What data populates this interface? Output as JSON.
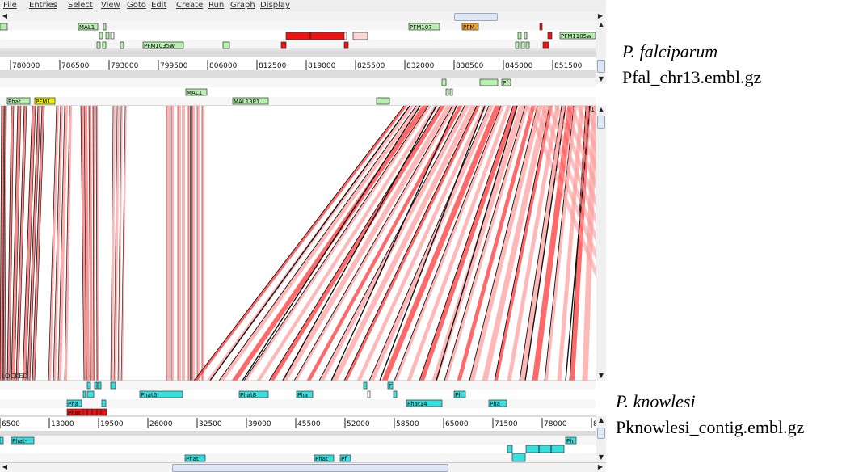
{
  "menu": [
    "File",
    "Entries",
    "Select",
    "View",
    "Goto",
    "Edit",
    "Create",
    "Run",
    "Graph",
    "Display"
  ],
  "top_genome": {
    "species": "P. falciparum",
    "file": "Pfal_chr13.embl.gz",
    "ruler_ticks": [
      "780000",
      "786500",
      "793000",
      "799500",
      "806000",
      "812500",
      "819000",
      "825500",
      "832000",
      "838500",
      "845000",
      "851500"
    ],
    "feature_labels": [
      "MAL1",
      "PFM107",
      "PFM",
      "PFM1035w",
      "PFM1105w"
    ],
    "lower_feature_labels": [
      "MAL1",
      "Pf",
      "Phat",
      "PFM1",
      "MAL13P1."
    ]
  },
  "bottom_genome": {
    "species": "P. knowlesi",
    "file": "Pknowlesi_contig.embl.gz",
    "ruler_ticks": [
      "6500",
      "13000",
      "19500",
      "26000",
      "32500",
      "39000",
      "45500",
      "52000",
      "58500",
      "65000",
      "71500",
      "78000",
      "84"
    ],
    "feature_labels": [
      "Phat6",
      "Phat8",
      "Pha",
      "Ph",
      "Pha",
      "Phat14",
      "Pha",
      "Phat",
      "F"
    ],
    "lower_feature_labels": [
      "Phat-",
      "Ph",
      "Phat",
      "Phat",
      "Pf"
    ]
  },
  "comparison": {
    "status_text": "LOCKED",
    "marker_right": "1"
  },
  "colors": {
    "match_dark": "#111111",
    "match_red": "#ff2a2a",
    "match_pink": "#ff9a9a",
    "gene_green": "#b8f0b0",
    "gene_cyan": "#34e0e0",
    "gene_red": "#ee1111",
    "gene_orange": "#f4a020",
    "gene_yellow": "#f4f400"
  }
}
